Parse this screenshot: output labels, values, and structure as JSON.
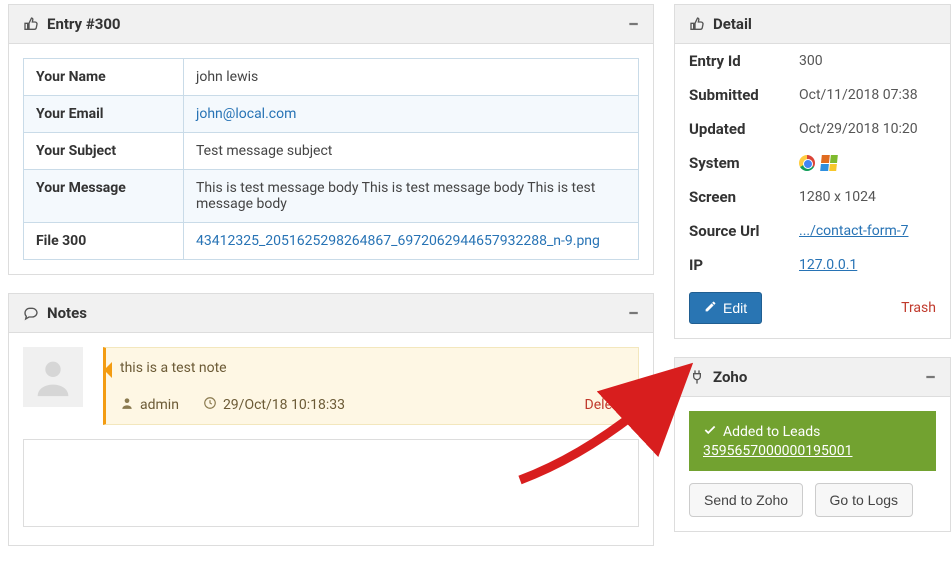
{
  "entry_panel": {
    "title": "Entry #300",
    "rows": [
      {
        "key": "Your Name",
        "val": "john lewis",
        "link": false
      },
      {
        "key": "Your Email",
        "val": "john@local.com",
        "link": true
      },
      {
        "key": "Your Subject",
        "val": "Test message subject",
        "link": false
      },
      {
        "key": "Your Message",
        "val": "This is test message body This is test message body This is test message body",
        "link": false
      },
      {
        "key": "File 300",
        "val": "43412325_2051625298264867_6972062944657932288_n-9.png",
        "link": true
      }
    ]
  },
  "notes_panel": {
    "title": "Notes",
    "note": {
      "text": "this is a test note",
      "user": "admin",
      "time": "29/Oct/18 10:18:33",
      "delete": "Delete"
    }
  },
  "detail_panel": {
    "title": "Detail",
    "entry_id_k": "Entry Id",
    "entry_id_v": "300",
    "submitted_k": "Submitted",
    "submitted_v": "Oct/11/2018 07:38",
    "updated_k": "Updated",
    "updated_v": "Oct/29/2018 10:20",
    "system_k": "System",
    "screen_k": "Screen",
    "screen_v": "1280 x 1024",
    "source_k": "Source Url",
    "source_v": ".../contact-form-7",
    "ip_k": "IP",
    "ip_v": "127.0.0.1",
    "edit": "Edit",
    "trash": "Trash"
  },
  "zoho_panel": {
    "title": "Zoho",
    "added": "Added to Leads",
    "lead_id": "3595657000000195001",
    "send": "Send to Zoho",
    "logs": "Go to Logs"
  }
}
